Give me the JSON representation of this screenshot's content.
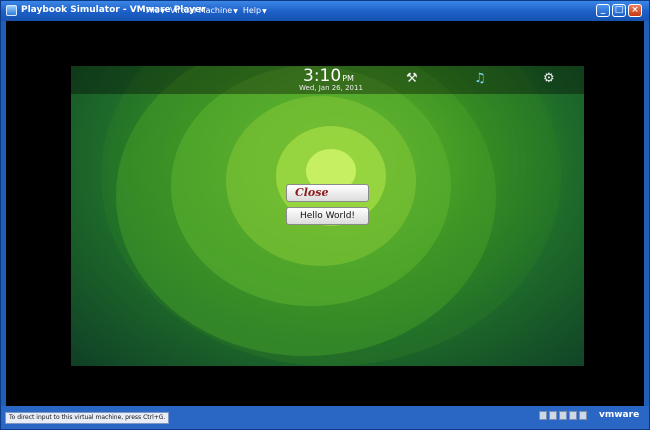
{
  "window": {
    "title": "Playbook Simulator - VMware Player",
    "menu": [
      "File",
      "Virtual Machine",
      "Help"
    ],
    "controls": [
      "_",
      "□",
      "×"
    ]
  },
  "tablet": {
    "time": "3:10",
    "ampm": "PM",
    "date": "Wed, Jan 26, 2011",
    "icons": [
      "hammer-icon",
      "music-note-icon",
      "gear-icon"
    ],
    "buttons": {
      "close_label": "Close",
      "hello_label": "Hello World!"
    }
  },
  "statusbar": {
    "hint": "To direct input to this virtual machine, press Ctrl+G.",
    "brand": "vmware"
  },
  "colors": {
    "titlebar": "#1c5fc7",
    "close_text": "#8b1a1a",
    "wallpaper": "#3c9422"
  }
}
